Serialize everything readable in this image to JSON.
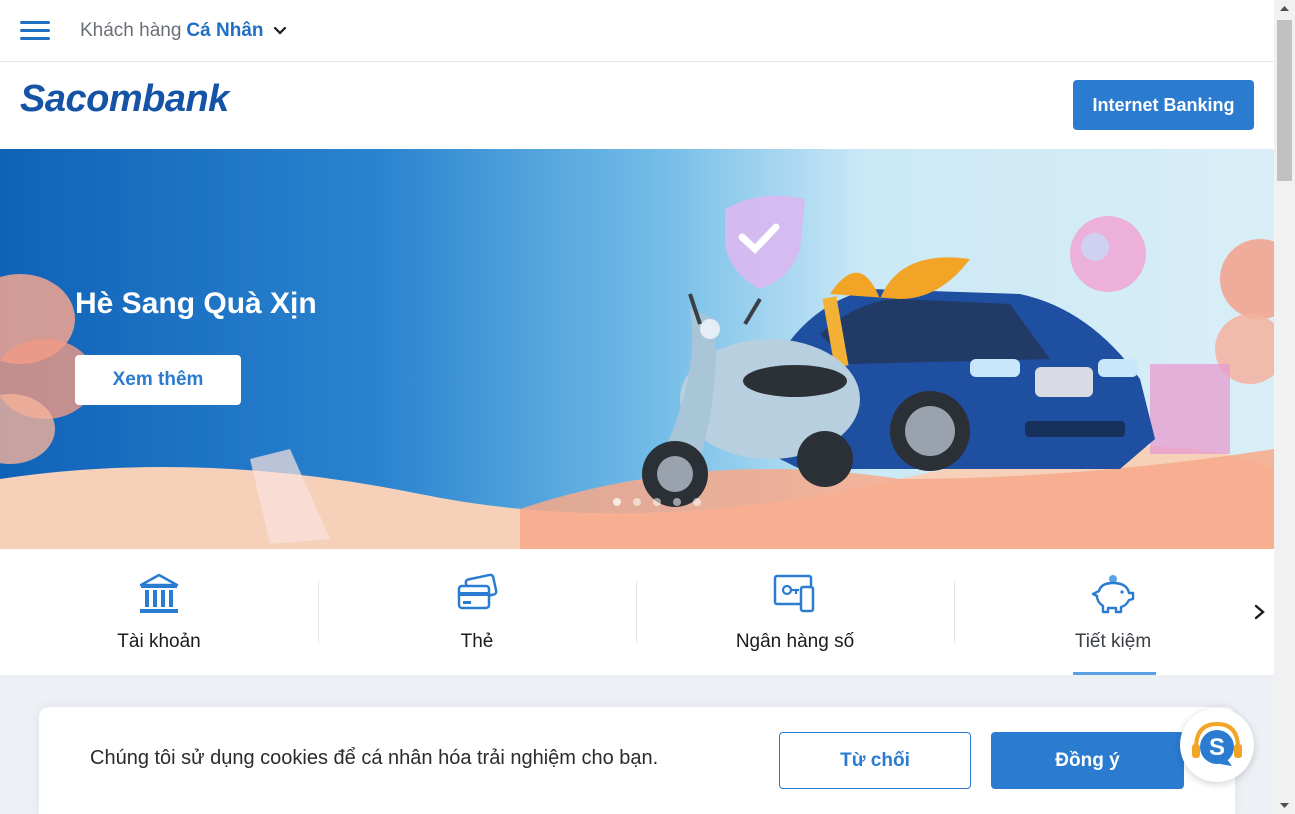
{
  "topbar": {
    "segment_prefix": "Khách hàng",
    "segment_value": "Cá Nhân"
  },
  "header": {
    "logo": "Sacombank",
    "internet_banking_label": "Internet Banking"
  },
  "hero": {
    "title": "Hè Sang Quà Xịn",
    "cta_label": "Xem thêm"
  },
  "quicknav": {
    "items": [
      {
        "label": "Tài khoản",
        "icon": "bank-icon"
      },
      {
        "label": "Thẻ",
        "icon": "card-icon"
      },
      {
        "label": "Ngân hàng số",
        "icon": "digital-banking-icon"
      },
      {
        "label": "Tiết kiệm",
        "icon": "piggy-bank-icon",
        "active": true
      }
    ]
  },
  "cookie": {
    "message": "Chúng tôi sử dụng cookies để cá nhân hóa trải nghiệm cho bạn.",
    "reject_label": "Từ chối",
    "accept_label": "Đồng ý"
  },
  "colors": {
    "brand_blue": "#2b7bd1",
    "logo_blue": "#1453a6"
  }
}
